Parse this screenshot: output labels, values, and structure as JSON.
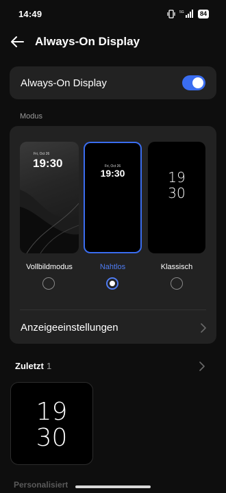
{
  "status_bar": {
    "time": "14:49",
    "network": "5G",
    "battery": "84",
    "icons": [
      "vibrate-icon",
      "signal-icon",
      "battery-icon"
    ]
  },
  "header": {
    "title": "Always-On Display",
    "back_icon": "back-arrow-icon"
  },
  "aod_toggle": {
    "label": "Always-On Display",
    "enabled": true
  },
  "mode_section": {
    "label": "Modus",
    "options": [
      {
        "name": "Vollbildmodus",
        "preview_date": "Fri, Oct 26",
        "preview_time": "19:30",
        "selected": false
      },
      {
        "name": "Nahtlos",
        "preview_date": "Fri, Oct 26",
        "preview_time": "19:30",
        "selected": true
      },
      {
        "name": "Klassisch",
        "preview_hour": "19",
        "preview_minute": "30",
        "selected": false
      }
    ],
    "display_settings_label": "Anzeigeeinstellungen"
  },
  "recent": {
    "title": "Zuletzt",
    "count": "1",
    "items": [
      {
        "hour": "19",
        "minute": "30"
      }
    ]
  },
  "partial_next_section": "Personalisiert",
  "colors": {
    "background": "#0e0e0e",
    "card": "#222222",
    "accent": "#3a6df0",
    "accent_text": "#4f7cf2",
    "secondary_text": "#9a9a9a"
  }
}
